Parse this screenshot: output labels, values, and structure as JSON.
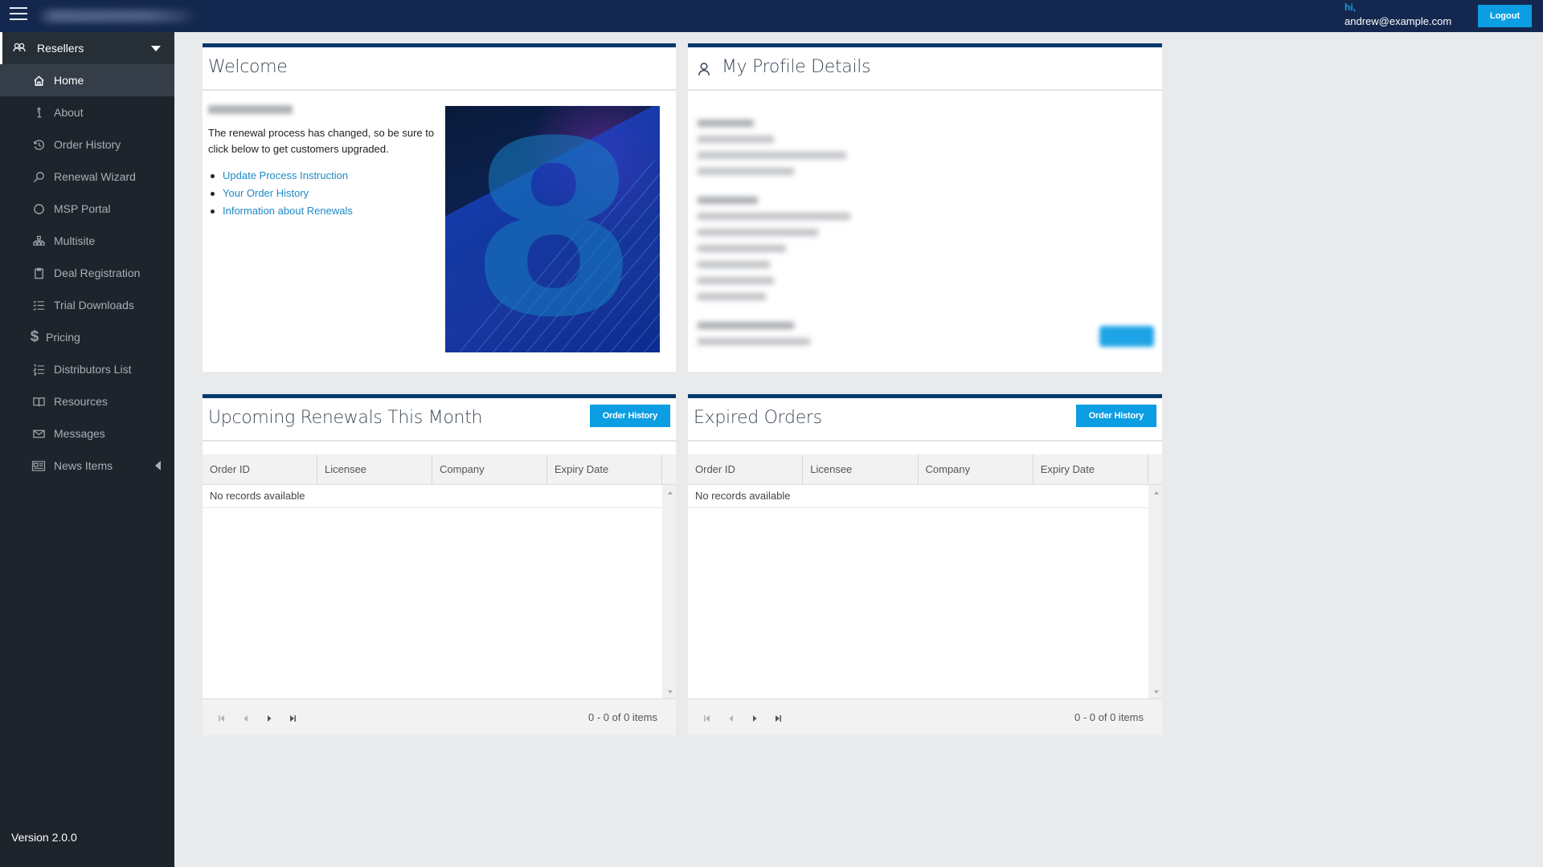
{
  "header": {
    "menu_icon": "hamburger-icon",
    "greeting": "hi,",
    "user_email": "andrew@example.com",
    "logout_label": "Logout"
  },
  "sidebar": {
    "group": {
      "label": "Resellers",
      "icon": "users-icon",
      "expanded": true
    },
    "items": [
      {
        "label": "Home",
        "icon": "home-icon",
        "active": true
      },
      {
        "label": "About",
        "icon": "info-icon"
      },
      {
        "label": "Order History",
        "icon": "history-icon"
      },
      {
        "label": "Renewal Wizard",
        "icon": "search-icon"
      },
      {
        "label": "MSP Portal",
        "icon": "circle-icon"
      },
      {
        "label": "Multisite",
        "icon": "sitemap-icon"
      },
      {
        "label": "Deal Registration",
        "icon": "clipboard-icon"
      },
      {
        "label": "Trial Downloads",
        "icon": "checklist-icon"
      },
      {
        "label": "Pricing",
        "icon": "dollar-icon",
        "glyph": "$"
      },
      {
        "label": "Distributors List",
        "icon": "numbered-list-icon"
      },
      {
        "label": "Resources",
        "icon": "book-icon"
      },
      {
        "label": "Messages",
        "icon": "envelope-icon"
      },
      {
        "label": "News Items",
        "icon": "newspaper-icon",
        "has_submenu": true
      }
    ],
    "version": "Version 2.0.0"
  },
  "welcome": {
    "title": "Welcome",
    "message": "The renewal process has changed, so be sure to click below to get customers upgraded.",
    "links": [
      "Update Process Instruction",
      "Your Order History",
      "Information about Renewals"
    ],
    "hero_glyph": "8"
  },
  "profile": {
    "title": "My Profile Details"
  },
  "renewals": {
    "title": "Upcoming Renewals This Month",
    "button_label": "Order History",
    "columns": [
      "Order ID",
      "Licensee",
      "Company",
      "Expiry Date"
    ],
    "empty_text": "No records available",
    "pager_info": "0 - 0 of 0 items"
  },
  "expired": {
    "title": "Expired Orders",
    "button_label": "Order History",
    "columns": [
      "Order ID",
      "Licensee",
      "Company",
      "Expiry Date"
    ],
    "empty_text": "No records available",
    "pager_info": "0 - 0 of 0 items"
  },
  "colors": {
    "topbar": "#14284f",
    "sidebar": "#1e242b",
    "accent_button": "#0b9ee2",
    "card_border": "#06396b",
    "link": "#1f89c6"
  }
}
